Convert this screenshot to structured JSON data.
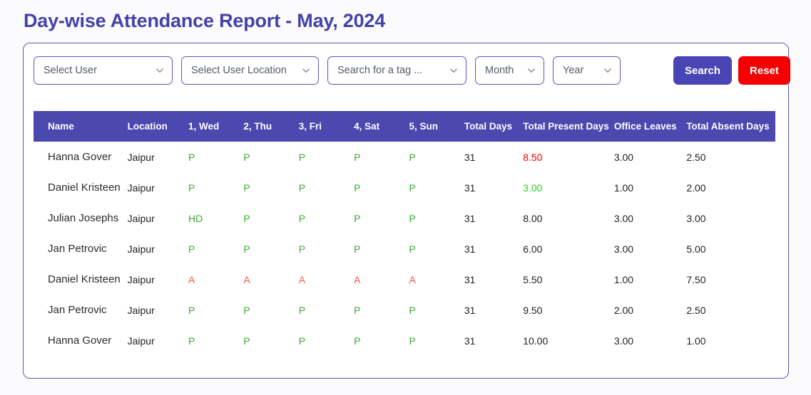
{
  "page_title": "Day-wise Attendance Report - May, 2024",
  "colors": {
    "title": "#4541a8",
    "header_bar": "#4b48b0",
    "search_button": "#4a45b5",
    "reset_button": "#f50000",
    "present": "#3ea832",
    "absent": "#f2594c",
    "value_red": "#ff0000",
    "value_green": "#2ecc20",
    "card_border": "#5b57c2"
  },
  "filters": {
    "user": {
      "label": "Select User",
      "icon": "chevron-down-icon"
    },
    "location": {
      "label": "Select User Location",
      "icon": "chevron-down-icon"
    },
    "tag": {
      "label": "Search for a tag ...",
      "icon": "chevron-down-icon"
    },
    "month": {
      "label": "Month",
      "icon": "chevron-down-icon"
    },
    "year": {
      "label": "Year",
      "icon": "chevron-down-icon"
    },
    "search_button": "Search",
    "reset_button": "Reset"
  },
  "table": {
    "columns": [
      "Name",
      "Location",
      "1, Wed",
      "2, Thu",
      "3, Fri",
      "4, Sat",
      "5, Sun",
      "Total Days",
      "Total Present Days",
      "Office Leaves",
      "Total Absent Days"
    ],
    "rows": [
      {
        "name": "Hanna Gover",
        "location": "Jaipur",
        "days": [
          "P",
          "P",
          "P",
          "P",
          "P"
        ],
        "total_days": "31",
        "total_present_days": "8.50",
        "total_present_color": "red",
        "office_leaves": "3.00",
        "total_absent_days": "2.50"
      },
      {
        "name": "Daniel Kristeen",
        "location": "Jaipur",
        "days": [
          "P",
          "P",
          "P",
          "P",
          "P"
        ],
        "total_days": "31",
        "total_present_days": "3.00",
        "total_present_color": "green",
        "office_leaves": "1.00",
        "total_absent_days": "2.00"
      },
      {
        "name": "Julian Josephs",
        "location": "Jaipur",
        "days": [
          "HD",
          "P",
          "P",
          "P",
          "P"
        ],
        "total_days": "31",
        "total_present_days": "8.00",
        "total_present_color": "default",
        "office_leaves": "3.00",
        "total_absent_days": "3.00"
      },
      {
        "name": "Jan Petrovic",
        "location": "Jaipur",
        "days": [
          "P",
          "P",
          "P",
          "P",
          "P"
        ],
        "total_days": "31",
        "total_present_days": "6.00",
        "total_present_color": "default",
        "office_leaves": "3.00",
        "total_absent_days": "5.00"
      },
      {
        "name": "Daniel Kristeen",
        "location": "Jaipur",
        "days": [
          "A",
          "A",
          "A",
          "A",
          "A"
        ],
        "total_days": "31",
        "total_present_days": "5.50",
        "total_present_color": "default",
        "office_leaves": "1.00",
        "total_absent_days": "7.50"
      },
      {
        "name": "Jan Petrovic",
        "location": "Jaipur",
        "days": [
          "P",
          "P",
          "P",
          "P",
          "P"
        ],
        "total_days": "31",
        "total_present_days": "9.50",
        "total_present_color": "default",
        "office_leaves": "2.00",
        "total_absent_days": "2.50"
      },
      {
        "name": "Hanna Gover",
        "location": "Jaipur",
        "days": [
          "P",
          "P",
          "P",
          "P",
          "P"
        ],
        "total_days": "31",
        "total_present_days": "10.00",
        "total_present_color": "default",
        "office_leaves": "3.00",
        "total_absent_days": "1.00"
      }
    ]
  }
}
